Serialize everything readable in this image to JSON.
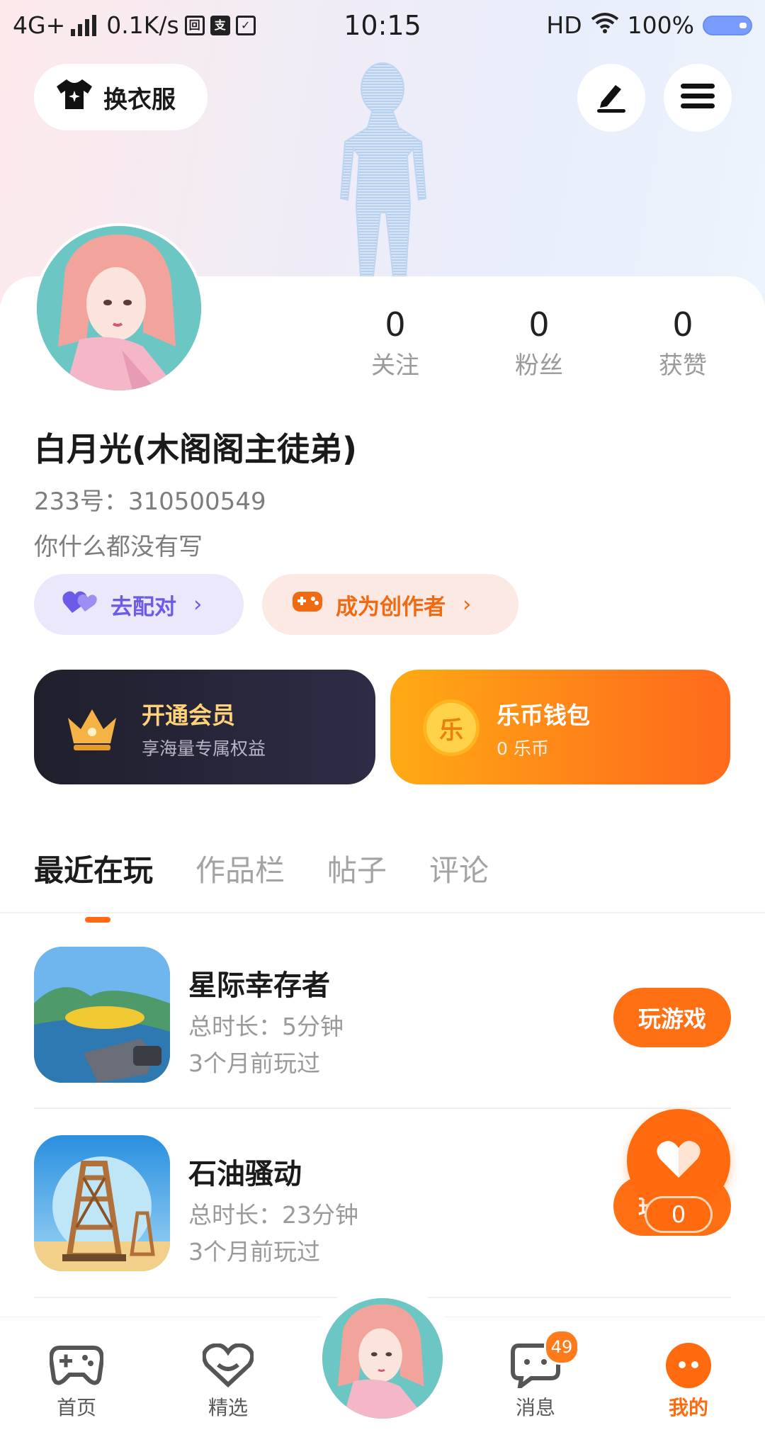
{
  "status_bar": {
    "network": "4G+",
    "speed": "0.1K/s",
    "time": "10:15",
    "hd": "HD",
    "battery": "100%"
  },
  "header": {
    "change_outfit": "换衣服"
  },
  "profile": {
    "stats": [
      {
        "value": "0",
        "label": "关注"
      },
      {
        "value": "0",
        "label": "粉丝"
      },
      {
        "value": "0",
        "label": "获赞"
      }
    ],
    "name": "白月光(木阁阁主徒弟)",
    "uid": "233号：310500549",
    "bio": "你什么都没有写",
    "match_label": "去配对",
    "creator_label": "成为创作者"
  },
  "cards": {
    "vip_title": "开通会员",
    "vip_sub": "享海量专属权益",
    "wallet_title": "乐币钱包",
    "wallet_sub": "0 乐币",
    "coin_char": "乐"
  },
  "tabs": [
    "最近在玩",
    "作品栏",
    "帖子",
    "评论"
  ],
  "games": [
    {
      "title": "星际幸存者",
      "duration": "总时长：5分钟",
      "last_played": "3个月前玩过",
      "button": "玩游戏"
    },
    {
      "title": "石油骚动",
      "duration": "总时长：23分钟",
      "last_played": "3个月前玩过",
      "button": "玩游戏"
    }
  ],
  "floating": {
    "count": "0"
  },
  "bottom_nav": {
    "home": "首页",
    "featured": "精选",
    "messages": "消息",
    "messages_badge": "49",
    "mine": "我的"
  },
  "colors": {
    "accent": "#ff6a14",
    "purple": "#6c5be6",
    "gold": "#ffd27a"
  }
}
